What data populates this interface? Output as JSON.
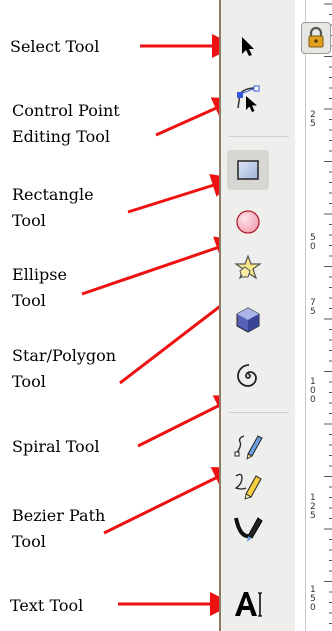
{
  "labels": {
    "select": "Select Tool",
    "node_line1": "Control Point",
    "node_line2": "Editing Tool",
    "rect_line1": "Rectangle",
    "rect_line2": "Tool",
    "ellipse_line1": "Ellipse",
    "ellipse_line2": "Tool",
    "star_line1": "Star/Polygon",
    "star_line2": "Tool",
    "spiral": "Spiral Tool",
    "bezier_line1": "Bezier Path",
    "bezier_line2": "Tool",
    "text": "Text Tool"
  },
  "ruler_labels": [
    "2​5",
    "5​0",
    "7​5",
    "1​0​0",
    "1​2​5",
    "1​5​0"
  ],
  "colors": {
    "arrow": "#ee1111",
    "toolbar": "#eeeeec",
    "active": "#d6d6d2"
  },
  "tools": [
    {
      "name": "select-icon"
    },
    {
      "name": "node-icon"
    },
    {
      "name": "rectangle-icon",
      "active": true
    },
    {
      "name": "ellipse-icon"
    },
    {
      "name": "star-icon"
    },
    {
      "name": "3d-box-icon"
    },
    {
      "name": "spiral-icon"
    },
    {
      "name": "pencil-icon"
    },
    {
      "name": "pen-icon"
    },
    {
      "name": "calligraphy-icon"
    },
    {
      "name": "text-icon"
    }
  ]
}
